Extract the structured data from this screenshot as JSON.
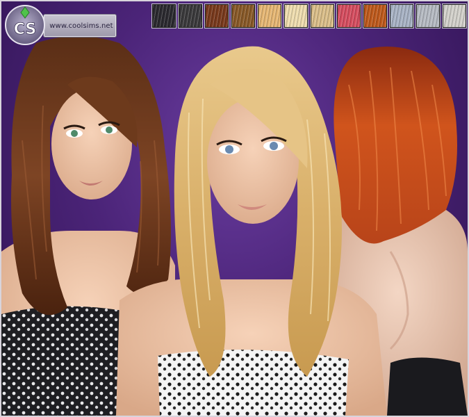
{
  "site": {
    "url": "www.coolsims.net"
  },
  "logo": {
    "initials": "CS",
    "icon": "coolsims-plumbob-logo"
  },
  "swatches": [
    {
      "name": "black",
      "color": "#2b2a30"
    },
    {
      "name": "soft-black",
      "color": "#3b3a3c"
    },
    {
      "name": "auburn-brown",
      "color": "#7a3a1c"
    },
    {
      "name": "golden-brown",
      "color": "#8a5a28"
    },
    {
      "name": "honey-blonde",
      "color": "#e8b874"
    },
    {
      "name": "light-blonde",
      "color": "#f1dfb0"
    },
    {
      "name": "sandy-blonde",
      "color": "#dcc08a"
    },
    {
      "name": "pink",
      "color": "#d84e60"
    },
    {
      "name": "copper-red",
      "color": "#c05a1c"
    },
    {
      "name": "silver-blue",
      "color": "#a9b4c6"
    },
    {
      "name": "gray",
      "color": "#b7bcc4"
    },
    {
      "name": "platinum",
      "color": "#d4d2cc"
    }
  ],
  "models": [
    {
      "name": "brunette-model-front",
      "hair": "#6b3a1e"
    },
    {
      "name": "blonde-model-front",
      "hair": "#e3c084"
    },
    {
      "name": "redhead-model-back",
      "hair": "#c2481a"
    }
  ]
}
